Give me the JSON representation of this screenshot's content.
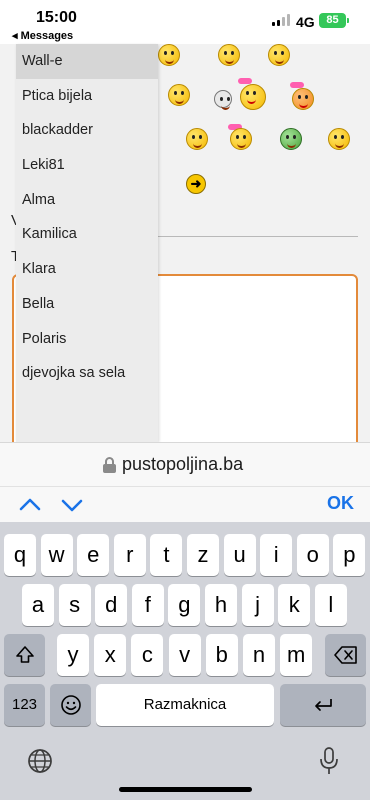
{
  "status_bar": {
    "time": "15:00",
    "back_label": "◂ Messages",
    "network": "4G",
    "battery": "85"
  },
  "page": {
    "hidden_letter_1": "V",
    "hidden_letter_2": "T"
  },
  "dropdown": {
    "items": [
      "Wall-e",
      "Ptica bijela",
      "blackadder",
      "Leki81",
      "Alma",
      "Kamilica",
      "Klara",
      "Bella",
      "Polaris",
      "djevojka sa sela"
    ],
    "selected_index": 0
  },
  "url_bar": {
    "url": "pustopoljina.ba"
  },
  "assistant_bar": {
    "ok_label": "OK"
  },
  "keyboard": {
    "row1": [
      "q",
      "w",
      "e",
      "r",
      "t",
      "z",
      "u",
      "i",
      "o",
      "p"
    ],
    "row2": [
      "a",
      "s",
      "d",
      "f",
      "g",
      "h",
      "j",
      "k",
      "l"
    ],
    "row3": [
      "y",
      "x",
      "c",
      "v",
      "b",
      "n",
      "m"
    ],
    "numbers_label": "123",
    "space_label": "Razmaknica"
  }
}
